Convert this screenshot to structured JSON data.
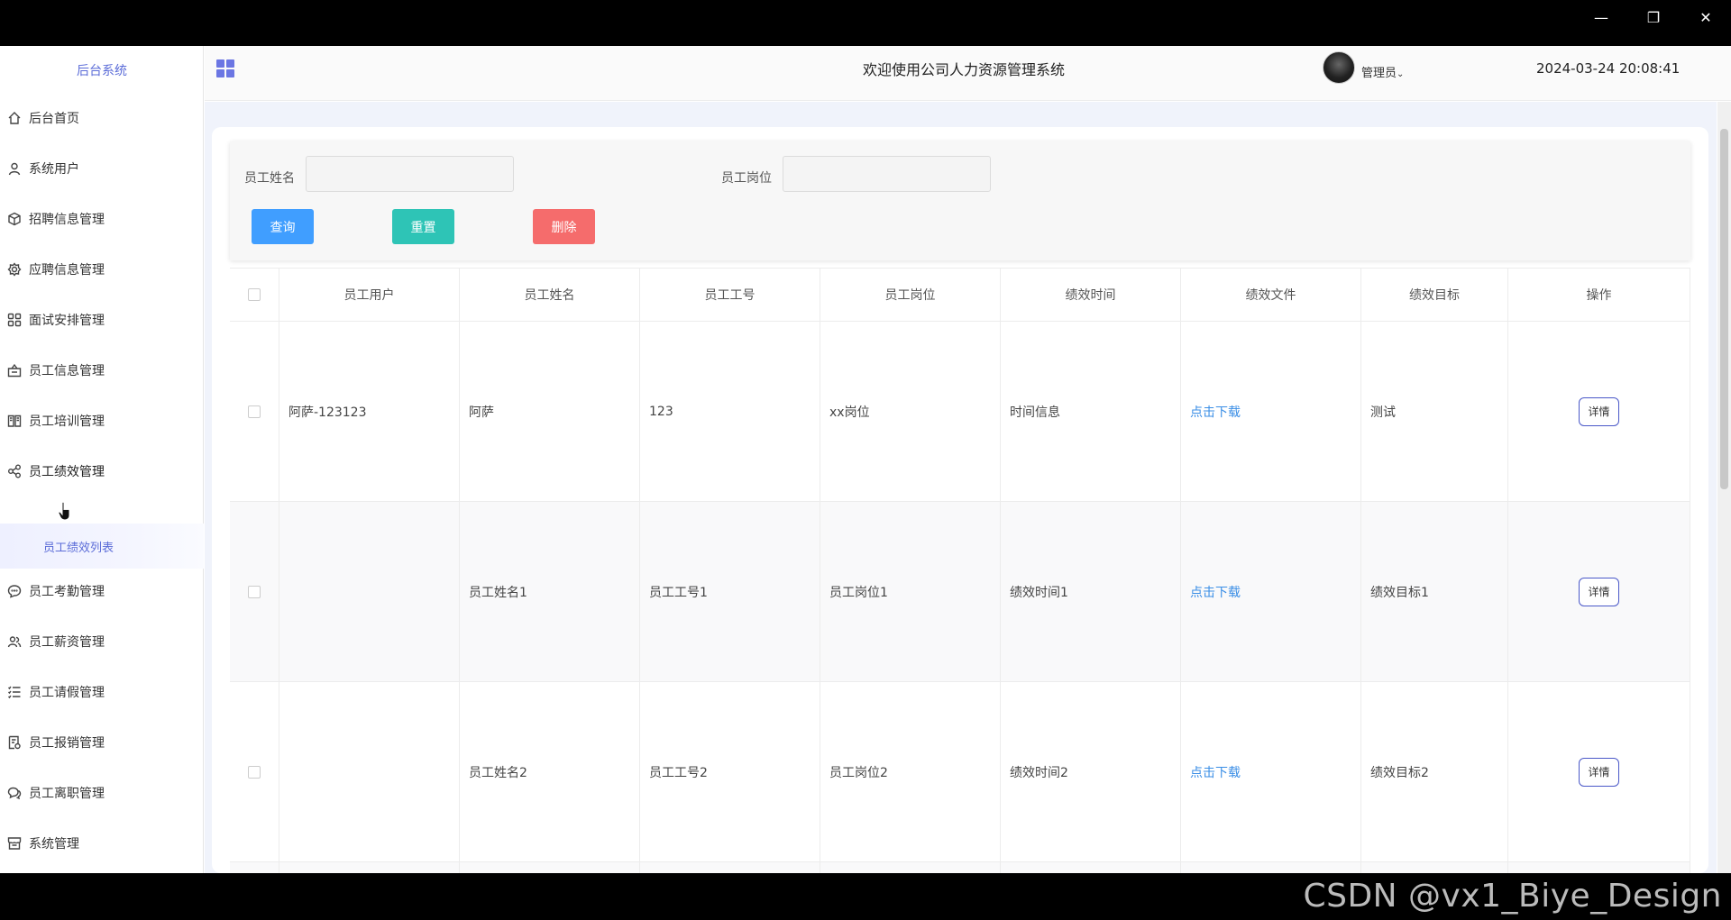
{
  "window": {
    "minimize": "—",
    "restore": "❐",
    "close": "✕"
  },
  "sidebar": {
    "brand": "后台系统",
    "items": [
      {
        "label": "后台首页",
        "icon": "home-icon"
      },
      {
        "label": "系统用户",
        "icon": "user-icon"
      },
      {
        "label": "招聘信息管理",
        "icon": "cube-icon"
      },
      {
        "label": "应聘信息管理",
        "icon": "gear-icon"
      },
      {
        "label": "面试安排管理",
        "icon": "grid-icon"
      },
      {
        "label": "员工信息管理",
        "icon": "briefcase-icon"
      },
      {
        "label": "员工培训管理",
        "icon": "book-icon"
      },
      {
        "label": "员工绩效管理",
        "icon": "share-icon"
      },
      {
        "label": "员工考勤管理",
        "icon": "chat-icon"
      },
      {
        "label": "员工薪资管理",
        "icon": "users-icon"
      },
      {
        "label": "员工请假管理",
        "icon": "list-icon"
      },
      {
        "label": "员工报销管理",
        "icon": "receipt-icon"
      },
      {
        "label": "员工离职管理",
        "icon": "chat-bubbles-icon"
      },
      {
        "label": "系统管理",
        "icon": "shop-icon"
      }
    ],
    "sub_item": "员工绩效列表"
  },
  "header": {
    "title": "欢迎使用公司人力资源管理系统",
    "user": "管理员",
    "datetime": "2024-03-24 20:08:41"
  },
  "search": {
    "name_label": "员工姓名",
    "post_label": "员工岗位",
    "name_value": "",
    "post_value": "",
    "query_label": "查询",
    "reset_label": "重置",
    "delete_label": "删除",
    "colors": {
      "query": "#409eff",
      "reset": "#2ec4b6",
      "delete": "#f56c6c"
    }
  },
  "table": {
    "columns": [
      "员工用户",
      "员工姓名",
      "员工工号",
      "员工岗位",
      "绩效时间",
      "绩效文件",
      "绩效目标",
      "操作"
    ],
    "rows": [
      {
        "user": "阿萨-123123",
        "name": "阿萨",
        "id": "123",
        "post": "xx岗位",
        "time": "时间信息",
        "file": "点击下载",
        "goal": "测试",
        "action": "详情"
      },
      {
        "user": "",
        "name": "员工姓名1",
        "id": "员工工号1",
        "post": "员工岗位1",
        "time": "绩效时间1",
        "file": "点击下载",
        "goal": "绩效目标1",
        "action": "详情"
      },
      {
        "user": "",
        "name": "员工姓名2",
        "id": "员工工号2",
        "post": "员工岗位2",
        "time": "绩效时间2",
        "file": "点击下载",
        "goal": "绩效目标2",
        "action": "详情"
      }
    ]
  },
  "watermark": "CSDN @vx1_Biye_Design"
}
